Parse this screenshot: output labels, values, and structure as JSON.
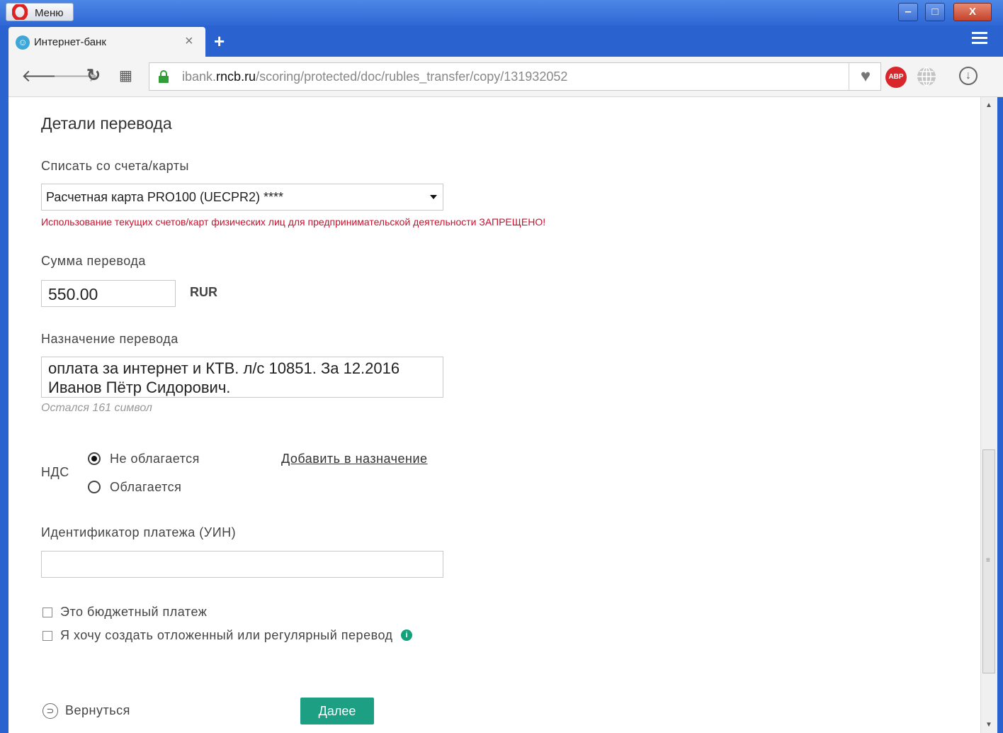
{
  "browser": {
    "menu_label": "Меню",
    "tab_title": "Интернет-банк",
    "tab_close": "×",
    "new_tab": "+",
    "url": {
      "prefix": "ibank.",
      "domain": "rncb.ru",
      "path": "/scoring/protected/doc/rubles_transfer/copy/131932052"
    },
    "abp_label": "ABP",
    "window_buttons": {
      "minimize": "‒",
      "maximize": "□",
      "close": "X"
    }
  },
  "form": {
    "section_title": "Детали перевода",
    "account_label": "Списать со счета/карты",
    "account_value": "Расчетная карта PRO100 (UECPR2) ****",
    "account_warning": "Использование текущих счетов/карт физических лиц для предпринимательской деятельности ЗАПРЕЩЕНО!",
    "amount_label": "Сумма перевода",
    "amount_value": "550.00",
    "currency": "RUR",
    "purpose_label": "Назначение перевода",
    "purpose_value": "оплата за интернет и КТВ. л/с 10851. За 12.2016\nИванов Пётр Сидорович.",
    "purpose_remaining": "Остался 161 символ",
    "vat_label": "НДС",
    "vat_options": [
      {
        "label": "Не облагается",
        "selected": true
      },
      {
        "label": "Облагается",
        "selected": false
      }
    ],
    "add_to_purpose_link": "Добавить в назначение",
    "uin_label": "Идентификатор платежа (УИН)",
    "uin_value": "",
    "budget_checkbox": "Это бюджетный платеж",
    "scheduled_checkbox": "Я хочу создать отложенный или регулярный перевод",
    "back_label": "Вернуться",
    "next_label": "Далее"
  },
  "colors": {
    "accent": "#1d9f84",
    "warning": "#c8102e",
    "frame": "#2a63cf"
  }
}
